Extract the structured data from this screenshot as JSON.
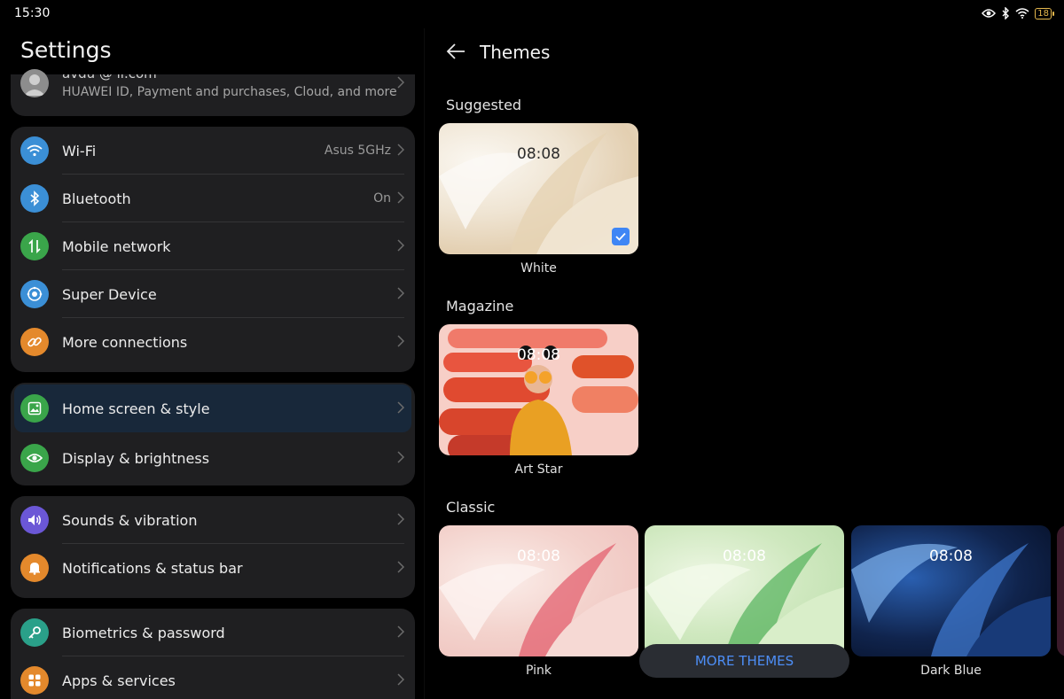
{
  "status": {
    "time": "15:30",
    "battery": "18"
  },
  "left": {
    "title": "Settings",
    "account": {
      "email": "avdu      @    il.com",
      "subtitle": "HUAWEI ID, Payment and purchases, Cloud, and more"
    },
    "groups": [
      [
        {
          "label": "Wi-Fi",
          "value": "Asus 5GHz",
          "icon": "wifi-icon",
          "color": "#3b8fd6"
        },
        {
          "label": "Bluetooth",
          "value": "On",
          "icon": "bluetooth-icon",
          "color": "#3b8fd6"
        },
        {
          "label": "Mobile network",
          "value": "",
          "icon": "mobile-network-icon",
          "color": "#3aa54a"
        },
        {
          "label": "Super Device",
          "value": "",
          "icon": "super-device-icon",
          "color": "#3b8fd6"
        },
        {
          "label": "More connections",
          "value": "",
          "icon": "link-icon",
          "color": "#e4892c"
        }
      ],
      [
        {
          "label": "Home screen & style",
          "value": "",
          "icon": "image-icon",
          "color": "#3aa54a"
        },
        {
          "label": "Display & brightness",
          "value": "",
          "icon": "eye-icon",
          "color": "#3aa54a"
        }
      ],
      [
        {
          "label": "Sounds & vibration",
          "value": "",
          "icon": "speaker-icon",
          "color": "#6b57d6"
        },
        {
          "label": "Notifications & status bar",
          "value": "",
          "icon": "bell-icon",
          "color": "#e4892c"
        }
      ],
      [
        {
          "label": "Biometrics & password",
          "value": "",
          "icon": "key-icon",
          "color": "#2aa089"
        },
        {
          "label": "Apps & services",
          "value": "",
          "icon": "apps-icon",
          "color": "#e4892c"
        }
      ]
    ]
  },
  "right": {
    "title": "Themes",
    "sections": {
      "suggested": "Suggested",
      "magazine": "Magazine",
      "classic": "Classic"
    },
    "themes": {
      "white": {
        "name": "White",
        "clock": "08:08"
      },
      "art_star": {
        "name": "Art Star",
        "clock": "08:08"
      },
      "pink": {
        "name": "Pink",
        "clock": "08:08"
      },
      "green": {
        "name": "",
        "clock": "08:08"
      },
      "dark_blue": {
        "name": "Dark Blue",
        "clock": "08:08"
      }
    },
    "more_button": "MORE THEMES"
  }
}
